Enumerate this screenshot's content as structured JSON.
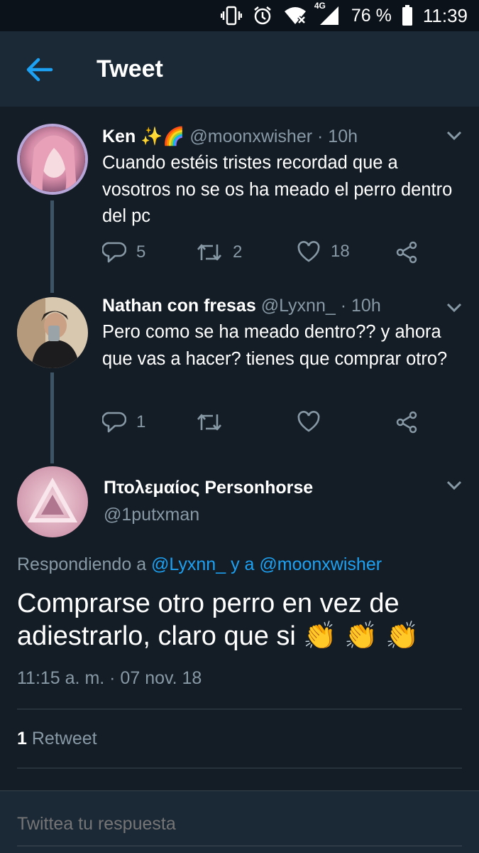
{
  "status_bar": {
    "network": "4G",
    "battery": "76 %",
    "time": "11:39"
  },
  "app_bar": {
    "title": "Tweet"
  },
  "thread": [
    {
      "name": "Ken",
      "name_emoji": "✨🌈",
      "handle": "@moonxwisher",
      "time": "· 10h",
      "text": "Cuando estéis tristes recordad que a vosotros no se os ha meado el perro dentro del pc",
      "replies": "5",
      "retweets": "2",
      "likes": "18"
    },
    {
      "name": "Nathan con fresas",
      "handle": "@Lyxnn_",
      "time": "· 10h",
      "text": "Pero como se ha meado dentro?? y ahora que vas a hacer? tienes que comprar otro?",
      "replies": "1",
      "retweets": "",
      "likes": ""
    }
  ],
  "main_tweet": {
    "name": "Πτολεμαίος Personhorse",
    "handle": "@1putxman",
    "replying_prefix": "Respondiendo a",
    "replying_user1": "@Lyxnn_",
    "replying_and": "y a",
    "replying_user2": "@moonxwisher",
    "text": "Comprarse otro perro en vez de adiestrarlo, claro que si 👏 👏 👏",
    "timestamp": "11:15 a. m. · 07 nov. 18",
    "retweet_count": "1",
    "retweet_label": "Retweet"
  },
  "reply_box": {
    "placeholder": "Twittea tu respuesta"
  },
  "colors": {
    "background": "#141d26",
    "bar": "#1b2836",
    "accent": "#1da1f2",
    "muted": "#8899a6"
  },
  "icons": [
    "back-arrow-icon",
    "chevron-down-icon",
    "reply-icon",
    "retweet-icon",
    "like-icon",
    "share-icon"
  ]
}
